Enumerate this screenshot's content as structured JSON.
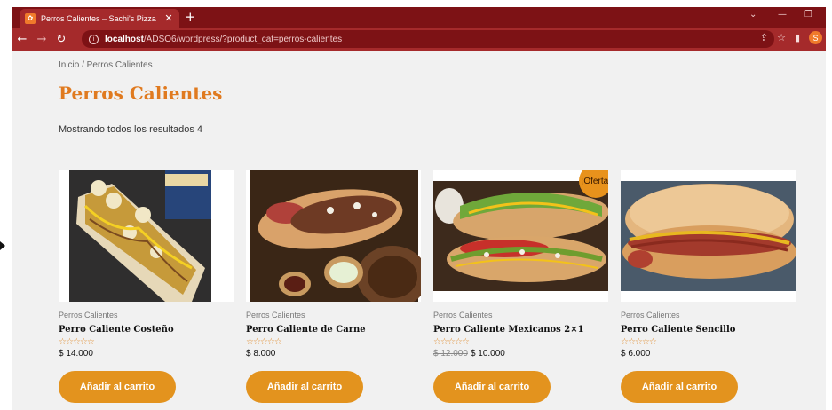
{
  "browser": {
    "tab_title": "Perros Calientes – Sachi's Pizza",
    "tab_favicon": "pizza-favicon",
    "url_host": "localhost",
    "url_path": "/ADSO6/wordpress/?product_cat=perros-calientes",
    "profile_initial": "S",
    "accent": "#a52a2b"
  },
  "breadcrumb": "Inicio / Perros Calientes",
  "page_title": "Perros Calientes",
  "results_text": "Mostrando todos los resultados 4",
  "products": [
    {
      "category": "Perros Calientes",
      "name": "Perro Caliente Costeño",
      "rating": "☆☆☆☆☆",
      "price": "$ 14.000",
      "old_price": "",
      "sale_badge": "",
      "button": "Añadir al carrito"
    },
    {
      "category": "Perros Calientes",
      "name": "Perro Caliente de Carne",
      "rating": "☆☆☆☆☆",
      "price": "$ 8.000",
      "old_price": "",
      "sale_badge": "",
      "button": "Añadir al carrito"
    },
    {
      "category": "Perros Calientes",
      "name": "Perro Caliente Mexicanos 2×1",
      "rating": "☆☆☆☆☆",
      "price": "$ 10.000",
      "old_price": "$ 12.000",
      "sale_badge": "¡Oferta!",
      "button": "Añadir al carrito"
    },
    {
      "category": "Perros Calientes",
      "name": "Perro Caliente Sencillo",
      "rating": "☆☆☆☆☆",
      "price": "$ 6.000",
      "old_price": "",
      "sale_badge": "",
      "button": "Añadir al carrito"
    }
  ],
  "colors": {
    "title": "#e07a1f",
    "button": "#e3931e",
    "page_bg": "#f1f1f1"
  }
}
